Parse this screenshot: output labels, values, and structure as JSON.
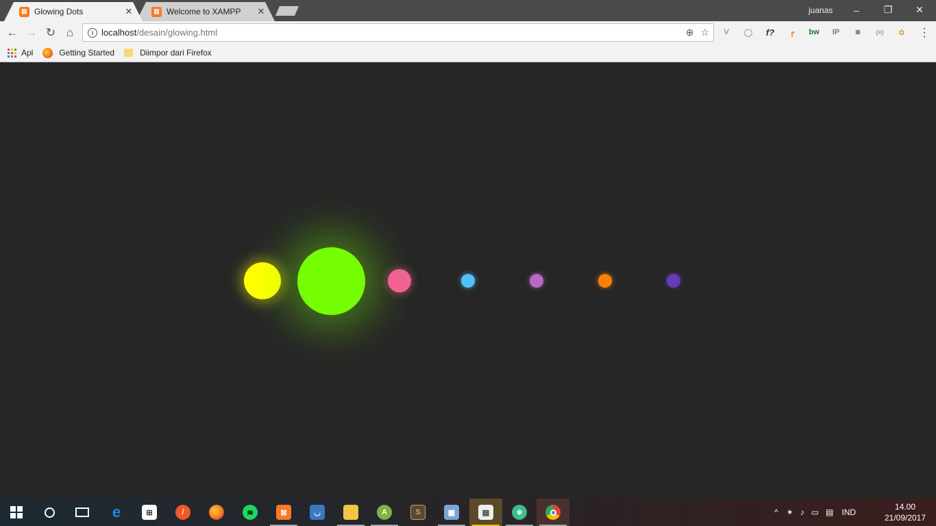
{
  "tabs": [
    {
      "title": "Glowing Dots",
      "active": true
    },
    {
      "title": "Welcome to XAMPP",
      "active": false
    }
  ],
  "window": {
    "user": "juanas",
    "minimize": "–",
    "restore": "❐",
    "close": "✕"
  },
  "toolbar": {
    "back": "←",
    "forward": "→",
    "reload": "↻",
    "home": "⌂",
    "url_host": "localhost",
    "url_path": "/desain/glowing.html",
    "zoom_icon": "⊕",
    "star_icon": "☆",
    "menu_icon": "⋮"
  },
  "extensions": [
    "V",
    "◯",
    "f?",
    "┏",
    "bw",
    "IP",
    "◙",
    "{≡}",
    "✿"
  ],
  "bookmarks": [
    {
      "label": "Apl",
      "icon": "apps-grid-icon"
    },
    {
      "label": "Getting Started",
      "icon": "firefox-icon"
    },
    {
      "label": "Diimpor dari Firefox",
      "icon": "folder-icon"
    }
  ],
  "dots": [
    {
      "name": "yellow",
      "color": "#ffff00"
    },
    {
      "name": "green",
      "color": "#76ff03"
    },
    {
      "name": "pink",
      "color": "#f06292"
    },
    {
      "name": "blue",
      "color": "#4fc3f7"
    },
    {
      "name": "purple",
      "color": "#ba68c8"
    },
    {
      "name": "orange",
      "color": "#ff8000"
    },
    {
      "name": "violet",
      "color": "#673ab7"
    }
  ],
  "taskbar": {
    "apps": [
      "start",
      "cortana",
      "task-view",
      "edge",
      "store",
      "brackets",
      "firefox",
      "spotify",
      "xampp",
      "finder",
      "explorer",
      "android-studio",
      "sublime",
      "photos",
      "movie-maker",
      "atom",
      "chrome"
    ],
    "language": "IND",
    "time": "14.00",
    "date": "21/09/2017"
  }
}
